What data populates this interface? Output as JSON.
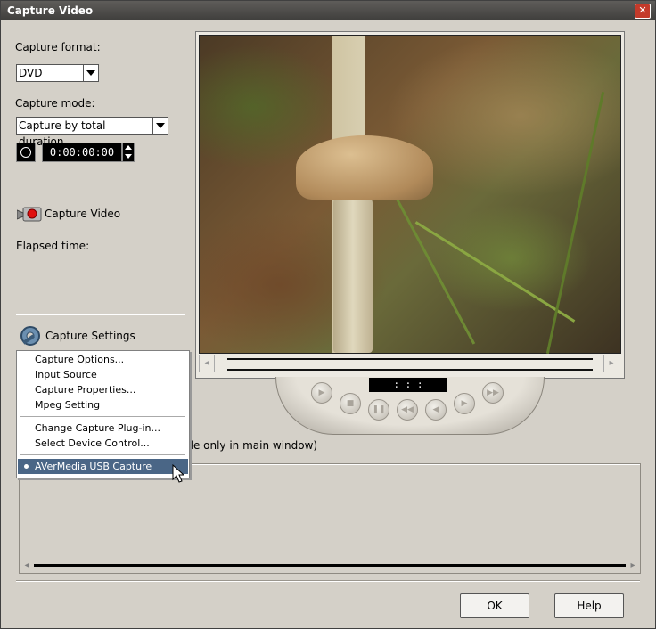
{
  "window": {
    "title": "Capture Video"
  },
  "capture": {
    "format_label": "Capture format:",
    "format_value": "DVD",
    "mode_label": "Capture mode:",
    "mode_value": "Capture by total duration",
    "duration_value": "0:00:00:00",
    "capture_video_label": "Capture Video",
    "elapsed_label": "Elapsed time:",
    "settings_label": "Capture Settings"
  },
  "preview": {
    "timecode": ":  :  :"
  },
  "partial_text": "ble only in main window)",
  "context_menu": {
    "items": [
      "Capture Options...",
      "Input Source",
      "Capture Properties...",
      "Mpeg Setting",
      "Change Capture Plug-in...",
      "Select Device Control...",
      "AVerMedia USB Capture"
    ]
  },
  "buttons": {
    "ok": "OK",
    "help": "Help"
  },
  "colors": {
    "menu_selection": "#4a6686",
    "titlebar": "#4a4846",
    "close": "#c43a2a"
  }
}
